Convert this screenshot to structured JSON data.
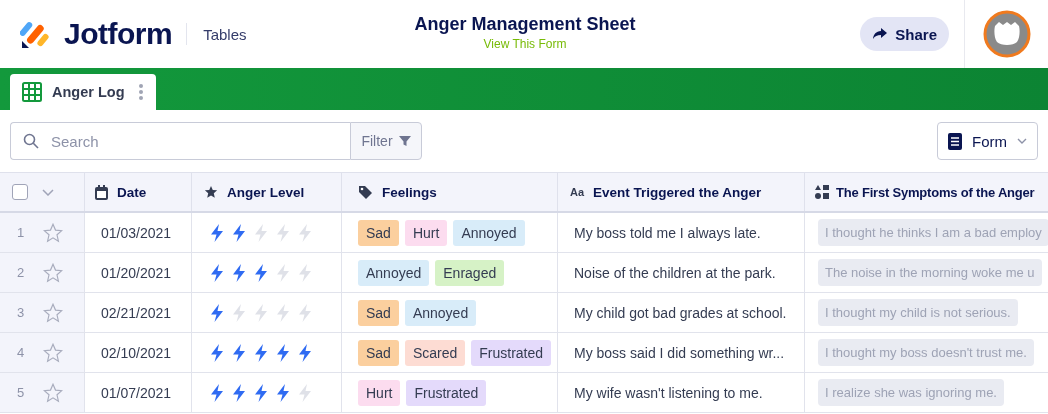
{
  "header": {
    "logo": "Jotform",
    "section": "Tables",
    "title": "Anger Management Sheet",
    "form_link": "View This Form",
    "share": "Share"
  },
  "tabs": [
    {
      "label": "Anger Log",
      "selected": true
    }
  ],
  "toolbar": {
    "search": {
      "placeholder": "Search"
    },
    "filter": "Filter",
    "view": "Form"
  },
  "table": {
    "select_all": {
      "checked": false
    },
    "columns": [
      {
        "label": "Date",
        "kind": "date"
      },
      {
        "label": "Anger Level",
        "kind": "rating"
      },
      {
        "label": "Feelings",
        "kind": "tags"
      },
      {
        "label": "Event Triggered the Anger",
        "kind": "text",
        "icon_label": "Aa"
      },
      {
        "label": "The First Symptoms of the Anger",
        "kind": "shapes"
      }
    ],
    "rows": [
      {
        "index": "1",
        "starred": false,
        "date": "01/03/2021",
        "stars": 2,
        "feelings": [
          {
            "label": "Sad",
            "color": "#fbcf9e"
          },
          {
            "label": "Hurt",
            "color": "#fcdcef"
          },
          {
            "label": "Annoyed",
            "color": "#d8ecf9"
          }
        ],
        "event": "My boss told me I always late.",
        "symptoms": "I thought he thinks I am a bad employ"
      },
      {
        "index": "2",
        "starred": false,
        "date": "01/20/2021",
        "stars": 3,
        "feelings": [
          {
            "label": "Annoyed",
            "color": "#d8ecf9"
          },
          {
            "label": "Enraged",
            "color": "#d6f2c6"
          }
        ],
        "event": "Noise of the children at the park.",
        "symptoms": "The noise in the morning woke me u"
      },
      {
        "index": "3",
        "starred": false,
        "date": "02/21/2021",
        "stars": 1,
        "feelings": [
          {
            "label": "Sad",
            "color": "#fbcf9e"
          },
          {
            "label": "Annoyed",
            "color": "#d8ecf9"
          }
        ],
        "event": "My child got bad grades at school.",
        "symptoms": "I thought my child is not serious."
      },
      {
        "index": "4",
        "starred": false,
        "date": "02/10/2021",
        "stars": 5,
        "feelings": [
          {
            "label": "Sad",
            "color": "#fbcf9e"
          },
          {
            "label": "Scared",
            "color": "#fddcd3"
          },
          {
            "label": "Frustrated",
            "color": "#e4dafb"
          }
        ],
        "event": "My boss said I did something wr...",
        "symptoms": "I thought my boss doesn't trust me."
      },
      {
        "index": "5",
        "starred": false,
        "date": "01/07/2021",
        "stars": 4,
        "feelings": [
          {
            "label": "Hurt",
            "color": "#fcdcef"
          },
          {
            "label": "Frustrated",
            "color": "#e4dafb"
          }
        ],
        "event": "My wife wasn't listening to me.",
        "symptoms": "I realize she was ignoring me."
      }
    ]
  }
}
